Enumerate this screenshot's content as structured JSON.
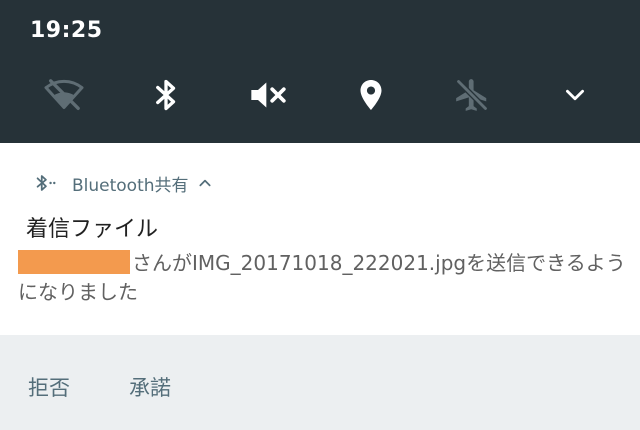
{
  "status_bar": {
    "time": "19:25"
  },
  "quick_settings": {
    "tiles": [
      {
        "icon": "wifi-off-icon",
        "state": "off"
      },
      {
        "icon": "bluetooth-icon",
        "state": "on"
      },
      {
        "icon": "volume-mute-icon",
        "state": "on"
      },
      {
        "icon": "location-icon",
        "state": "on"
      },
      {
        "icon": "airplane-off-icon",
        "state": "off"
      },
      {
        "icon": "chevron-down-icon",
        "state": "expand"
      }
    ],
    "colors": {
      "background": "#263238",
      "active": "#ffffff",
      "inactive": "#5f6d74"
    }
  },
  "notification": {
    "app_name": "Bluetooth共有",
    "title": "着信ファイル",
    "body_text": "さんがIMG_20171018_222021.jpgを送信できるようになりました",
    "redacted_color": "#f39a4e"
  },
  "actions": {
    "reject": "拒否",
    "accept": "承諾"
  }
}
